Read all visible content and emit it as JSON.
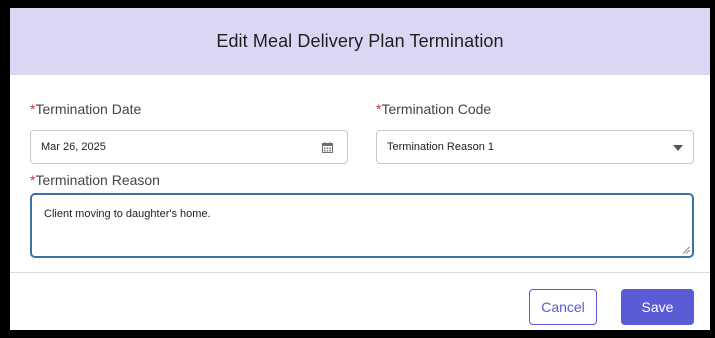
{
  "modal": {
    "title": "Edit Meal Delivery Plan Termination"
  },
  "form": {
    "required_marker": "*",
    "termination_date": {
      "label": "Termination Date",
      "value": "Mar 26, 2025",
      "icon": "calendar-icon"
    },
    "termination_code": {
      "label": "Termination Code",
      "value": "Termination Reason 1",
      "icon": "chevron-down-icon"
    },
    "termination_reason": {
      "label": "Termination Reason",
      "value": "Client moving to daughter's home."
    }
  },
  "footer": {
    "cancel_label": "Cancel",
    "save_label": "Save"
  },
  "colors": {
    "header_bg": "#dcd6f5",
    "primary": "#5b5bd6",
    "required": "#c23934",
    "focus_border": "#3d6fa8"
  }
}
